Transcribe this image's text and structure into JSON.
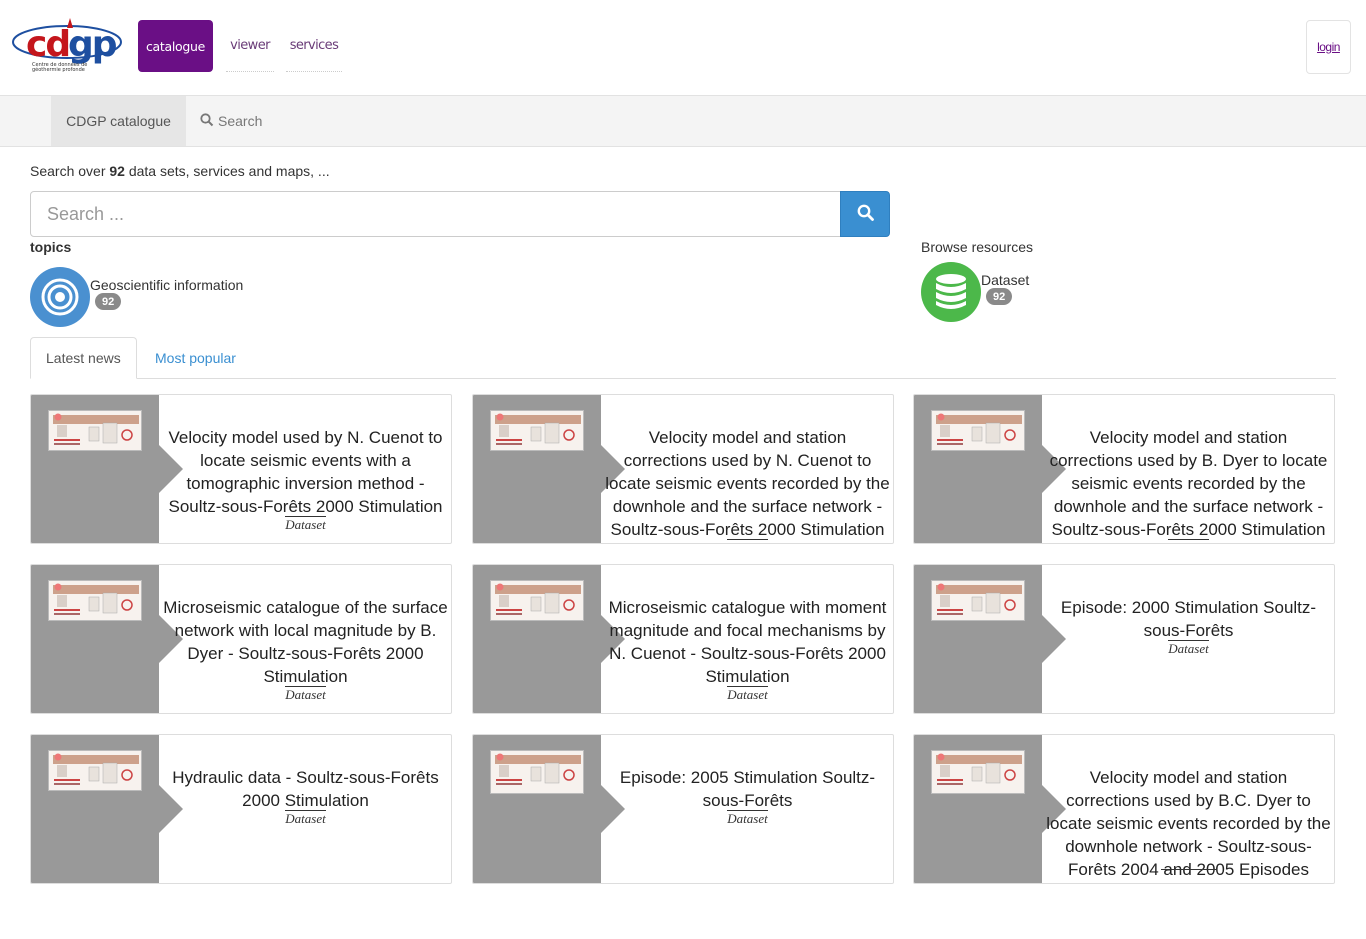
{
  "header": {
    "logo_text": "cdgp",
    "logo_subtitle": "Centre de données de géothermie profonde",
    "nav": [
      {
        "label": "catalogue",
        "active": true
      },
      {
        "label": "viewer",
        "active": false
      },
      {
        "label": "services",
        "active": false
      }
    ],
    "login_label": "login"
  },
  "subbar": {
    "brand": "CDGP catalogue",
    "search_label": "Search",
    "search_icon": "search-icon"
  },
  "search": {
    "prefix": "Search over",
    "count": "92",
    "suffix": "data sets, services and maps, ...",
    "placeholder": "Search ...",
    "button_icon": "search-icon"
  },
  "topics": {
    "label": "topics",
    "items": [
      {
        "name": "Geoscientific information",
        "count": "92",
        "icon": "target-icon",
        "color": "#4a90d0"
      }
    ]
  },
  "browse": {
    "label": "Browse resources",
    "items": [
      {
        "name": "Dataset",
        "count": "92",
        "icon": "database-icon",
        "color": "#4cb84a"
      }
    ]
  },
  "tabs": [
    {
      "label": "Latest news",
      "active": true
    },
    {
      "label": "Most popular",
      "active": false
    }
  ],
  "cards": [
    {
      "title": "Velocity model used by N. Cuenot to locate seismic events with a tomographic inversion method - Soultz-sous-Forêts 2000 Stimulation",
      "type": "Dataset"
    },
    {
      "title": "Velocity model and station corrections used by N. Cuenot to locate seismic events recorded by the downhole and the surface network - Soultz-sous-Forêts 2000 Stimulation",
      "type": "Dataset"
    },
    {
      "title": "Velocity model and station corrections used by B. Dyer to locate seismic events recorded by the downhole and the surface network - Soultz-sous-Forêts 2000 Stimulation",
      "type": "Dataset"
    },
    {
      "title": "Microseismic catalogue of the surface network with local magnitude by B. Dyer - Soultz-sous-Forêts 2000 Stimulation",
      "type": "Dataset"
    },
    {
      "title": "Microseismic catalogue with moment magnitude and focal mechanisms by N. Cuenot - Soultz-sous-Forêts 2000 Stimulation",
      "type": "Dataset"
    },
    {
      "title": "Episode: 2000 Stimulation Soultz-sous-Forêts",
      "type": "Dataset"
    },
    {
      "title": "Hydraulic data - Soultz-sous-Forêts 2000 Stimulation",
      "type": "Dataset"
    },
    {
      "title": "Episode: 2005 Stimulation Soultz-sous-Forêts",
      "type": "Dataset"
    },
    {
      "title": "Velocity model and station corrections used by B.C. Dyer to locate seismic events recorded by the downhole network - Soultz-sous-Forêts 2004 and 2005 Episodes",
      "type": ""
    }
  ],
  "colors": {
    "brand_purple": "#6a0f85",
    "accent_blue": "#3a8fd1",
    "card_gray": "#999999"
  }
}
